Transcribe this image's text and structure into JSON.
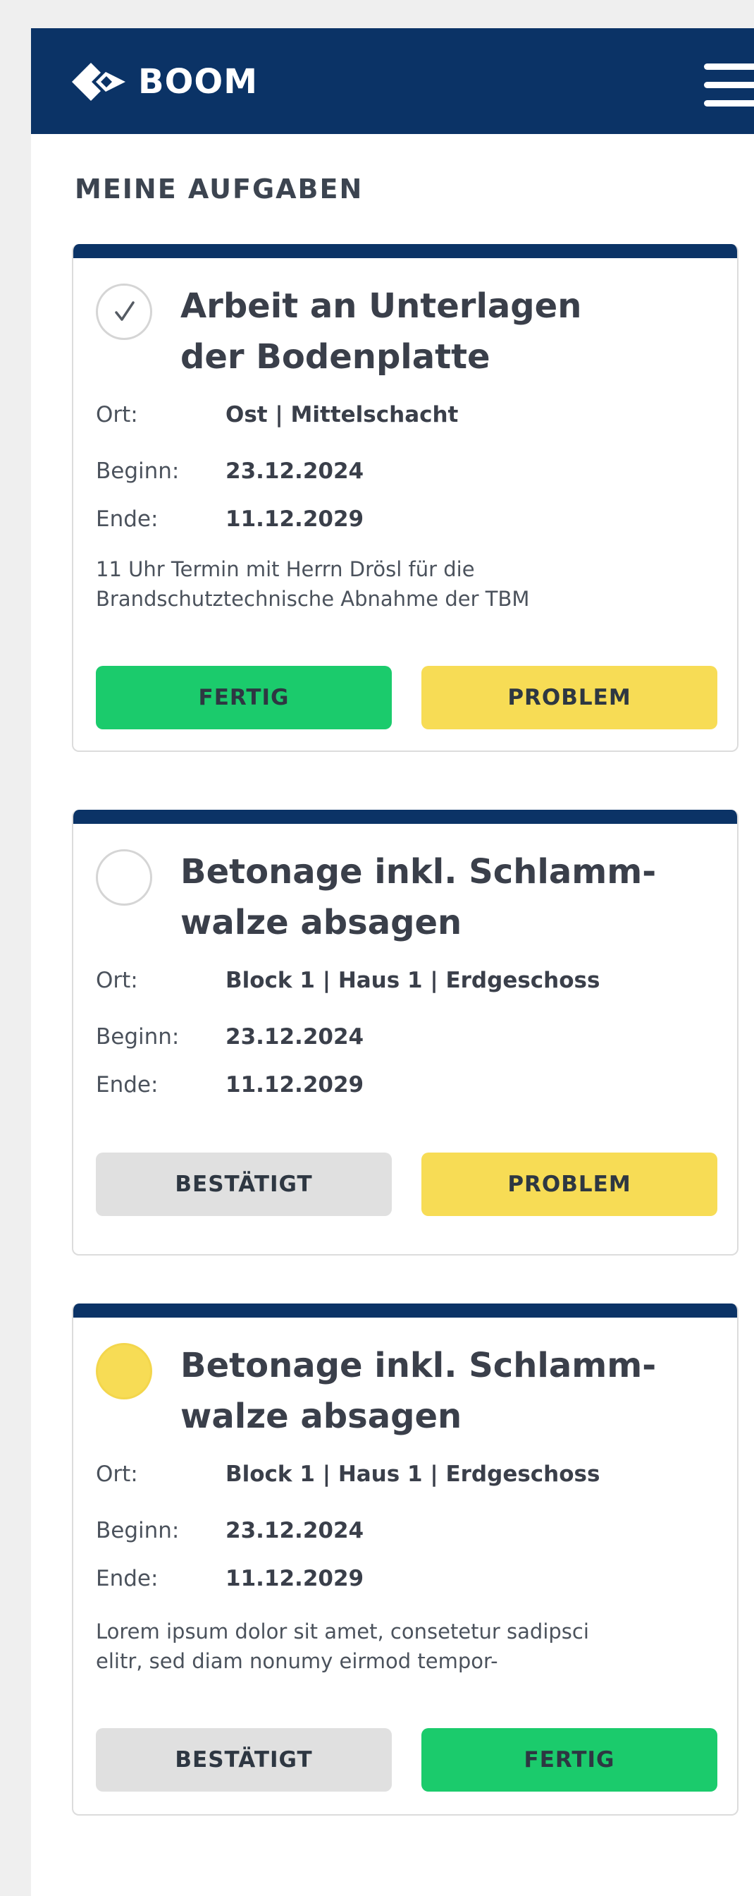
{
  "colors": {
    "header_bg": "#0b3366",
    "done_green": "#1bcb6c",
    "problem_yellow": "#f7dc55",
    "confirmed_grey": "#e0e0e0",
    "page_bg": "#efefef"
  },
  "header": {
    "brand": "BOOM",
    "logo_icon": "diamond-arrow-logo-icon",
    "menu_icon": "hamburger-menu-icon"
  },
  "page": {
    "title": "MEINE AUFGABEN"
  },
  "labels": {
    "ort": "Ort:",
    "beginn": "Beginn:",
    "ende": "Ende:"
  },
  "tasks": [
    {
      "status": "done",
      "status_icon": "checkmark-circle-icon",
      "title_lines": [
        "Arbeit an Unterlagen",
        "der Bodenplatte"
      ],
      "ort": "Ost | Mittelschacht",
      "beginn": "23.12.2024",
      "ende": "11.12.2029",
      "note_lines": [
        "11 Uhr Termin mit Herrn Drösl für die",
        "Brandschutztechnische Abnahme der TBM"
      ],
      "buttons": [
        {
          "label": "FERTIG",
          "color": "#1bcb6c"
        },
        {
          "label": "PROBLEM",
          "color": "#f7dc55"
        }
      ]
    },
    {
      "status": "open",
      "status_icon": "empty-circle-icon",
      "title_lines": [
        "Betonage inkl. Schlamm-",
        "walze absagen"
      ],
      "ort": "Block 1 | Haus 1 | Erdgeschoss",
      "beginn": "23.12.2024",
      "ende": "11.12.2029",
      "buttons": [
        {
          "label": "BESTÄTIGT",
          "color": "#e0e0e0"
        },
        {
          "label": "PROBLEM",
          "color": "#f7dc55"
        }
      ]
    },
    {
      "status": "pending",
      "status_icon": "yellow-circle-icon",
      "title_lines": [
        "Betonage inkl. Schlamm-",
        "walze absagen"
      ],
      "ort": "Block 1 | Haus 1 | Erdgeschoss",
      "beginn": "23.12.2024",
      "ende": "11.12.2029",
      "note_lines": [
        "Lorem ipsum dolor sit amet, consetetur sadipsci",
        "elitr, sed diam nonumy eirmod tempor-"
      ],
      "buttons": [
        {
          "label": "BESTÄTIGT",
          "color": "#e0e0e0"
        },
        {
          "label": "FERTIG",
          "color": "#1bcb6c"
        }
      ]
    }
  ]
}
